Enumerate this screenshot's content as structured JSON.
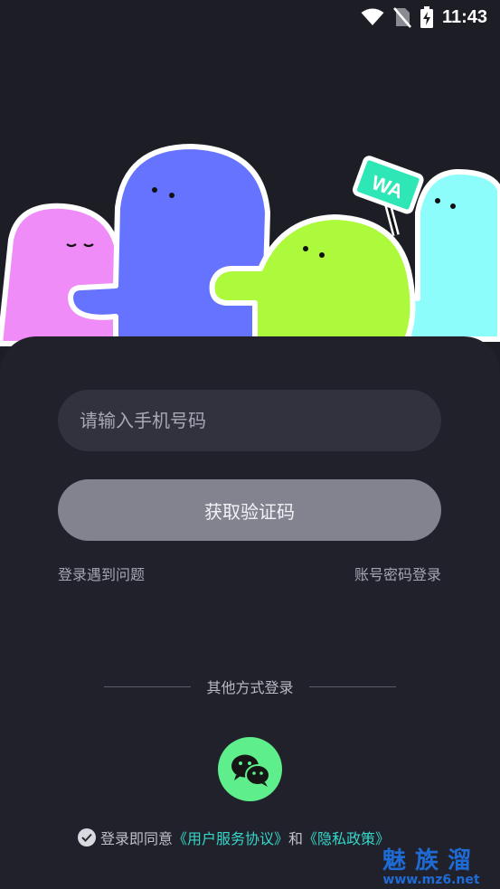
{
  "status_bar": {
    "time": "11:43",
    "icons": [
      "wifi-icon",
      "no-sim-icon",
      "battery-charging-icon"
    ]
  },
  "hero": {
    "sign_text": "WA",
    "colors": {
      "pink": "#ef8cf7",
      "blue": "#6673ff",
      "green": "#adfa3c",
      "cyan": "#8cfdfb",
      "sign": "#2ee6b6"
    }
  },
  "login": {
    "phone_placeholder": "请输入手机号码",
    "get_code_label": "获取验证码",
    "trouble_link": "登录遇到问题",
    "password_login_link": "账号密码登录"
  },
  "other_login": {
    "title": "其他方式登录",
    "wechat_icon": "wechat-icon"
  },
  "agreement": {
    "prefix": "登录即同意",
    "user_agreement": "《用户服务协议》",
    "and": "和",
    "privacy_policy": "《隐私政策》"
  },
  "watermark": {
    "top": "魅族溜",
    "bottom": "www.mz6.net"
  },
  "colors": {
    "background": "#1d1d26",
    "panel": "#21212b",
    "input": "#32323f",
    "button": "#82838f",
    "accent": "#35d7c9",
    "wechat": "#5eef8c"
  }
}
